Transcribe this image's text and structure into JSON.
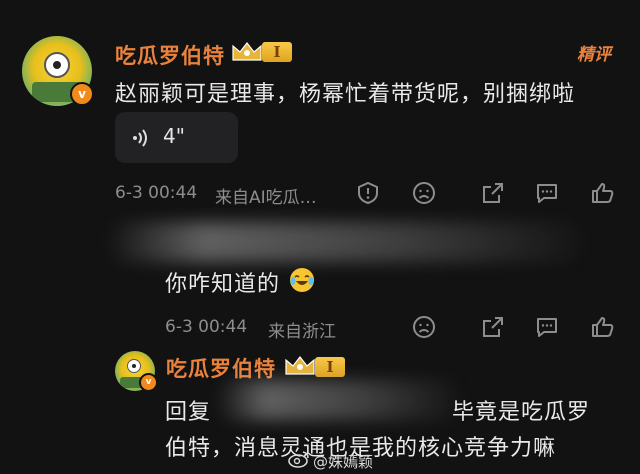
{
  "comments": [
    {
      "username": "吃瓜罗伯特",
      "level": "I",
      "featured_label": "精评",
      "text": "赵丽颖可是理事，杨幂忙着带货呢，别捆绑啦",
      "voice_duration": "4\"",
      "date": "6-3 00:44",
      "source": "来自AI吃瓜…"
    },
    {
      "text": "你咋知道的",
      "date": "6-3 00:44",
      "source": "来自浙江"
    },
    {
      "username": "吃瓜罗伯特",
      "level": "I",
      "reply_line1_prefix": "回复",
      "reply_line1_suffix": "毕竟是吃瓜罗",
      "reply_line2": "伯特，消息灵通也是我的核心竞争力嘛"
    }
  ],
  "watermark": "@姝嫣颖",
  "colors": {
    "accent": "#e8823c",
    "background": "#121212",
    "meta": "#8d8d8d"
  },
  "icons": [
    "report-icon",
    "dislike-icon",
    "share-icon",
    "comment-icon",
    "like-icon",
    "laughing-crying-emoji",
    "voice-wave-icon",
    "crown-icon",
    "v-verified-icon",
    "weibo-logo-icon"
  ]
}
